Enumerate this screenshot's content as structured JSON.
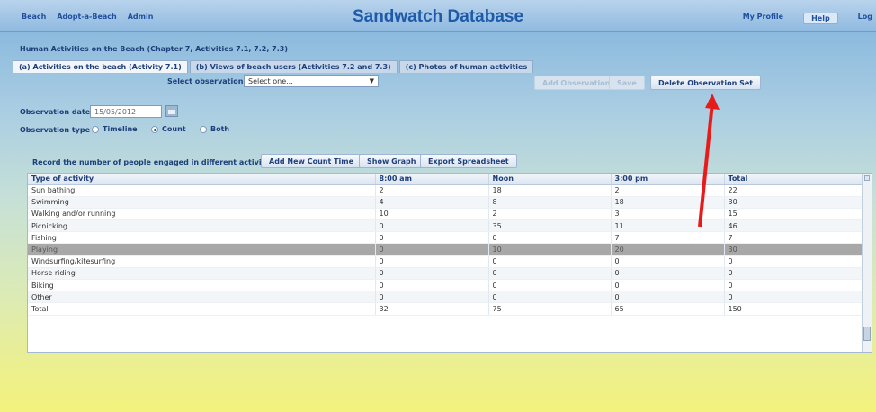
{
  "topnav": {
    "items": [
      "Beach",
      "Adopt-a-Beach",
      "Admin"
    ]
  },
  "app_title": "Sandwatch Database",
  "rightnav": {
    "profile": "My Profile",
    "help": "Help",
    "logout": "Log"
  },
  "section_title": "Human Activities on the Beach (Chapter 7, Activities 7.1, 7.2, 7.3)",
  "tabs": [
    "(a) Activities on the beach (Activity 7.1)",
    "(b) Views of beach users (Activities 7.2 and 7.3)",
    "(c) Photos of human activities"
  ],
  "select_obs": {
    "label": "Select observation date",
    "value": "Select one..."
  },
  "buttons": {
    "add_obs_set": "Add Observation",
    "save": "Save",
    "delete_obs_set": "Delete Observation Set",
    "add_count_time": "Add New Count Time",
    "show_graph": "Show Graph",
    "export": "Export Spreadsheet"
  },
  "obs_date": {
    "label": "Observation date",
    "value": "15/05/2012"
  },
  "obs_type": {
    "label": "Observation type",
    "options": [
      "Timeline",
      "Count",
      "Both"
    ],
    "selected": "Count"
  },
  "record_label": "Record the number of people engaged in different activities",
  "table": {
    "headers": [
      "Type of activity",
      "8:00 am",
      "Noon",
      "3:00 pm",
      "Total"
    ],
    "rows": [
      [
        "Sun bathing",
        "2",
        "18",
        "2",
        "22"
      ],
      [
        "Swimming",
        "4",
        "8",
        "18",
        "30"
      ],
      [
        "Walking and/or running",
        "10",
        "2",
        "3",
        "15"
      ],
      [
        "Picnicking",
        "0",
        "35",
        "11",
        "46"
      ],
      [
        "Fishing",
        "0",
        "0",
        "7",
        "7"
      ],
      [
        "Playing",
        "0",
        "10",
        "20",
        "30"
      ],
      [
        "Windsurfing/kitesurfing",
        "0",
        "0",
        "0",
        "0"
      ],
      [
        "Horse riding",
        "0",
        "0",
        "0",
        "0"
      ],
      [
        "Biking",
        "0",
        "0",
        "0",
        "0"
      ],
      [
        "Other",
        "0",
        "0",
        "0",
        "0"
      ],
      [
        "Total",
        "32",
        "75",
        "65",
        "150"
      ]
    ],
    "selected_row": 5
  },
  "annotation_color": "#e81b1b"
}
